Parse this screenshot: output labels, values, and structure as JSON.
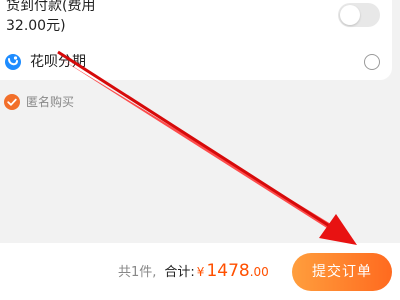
{
  "payment": {
    "cod": {
      "label": "货到付款(费用\n32.00元)",
      "toggle_on": false
    },
    "huabei": {
      "icon": "huabei-icon",
      "label": "花呗分期",
      "selected": false
    }
  },
  "anonymous": {
    "label": "匿名购买",
    "checked": true
  },
  "footer": {
    "count": "共1件,",
    "total_label": "合计:",
    "currency": "¥",
    "amount_int": "1478",
    "amount_dec": ".00",
    "submit_label": "提交订单"
  },
  "colors": {
    "accent": "#ff5000",
    "button_gradient_start": "#ff9e3d",
    "button_gradient_end": "#ff6a1f",
    "annotation_arrow": "#e81212"
  }
}
